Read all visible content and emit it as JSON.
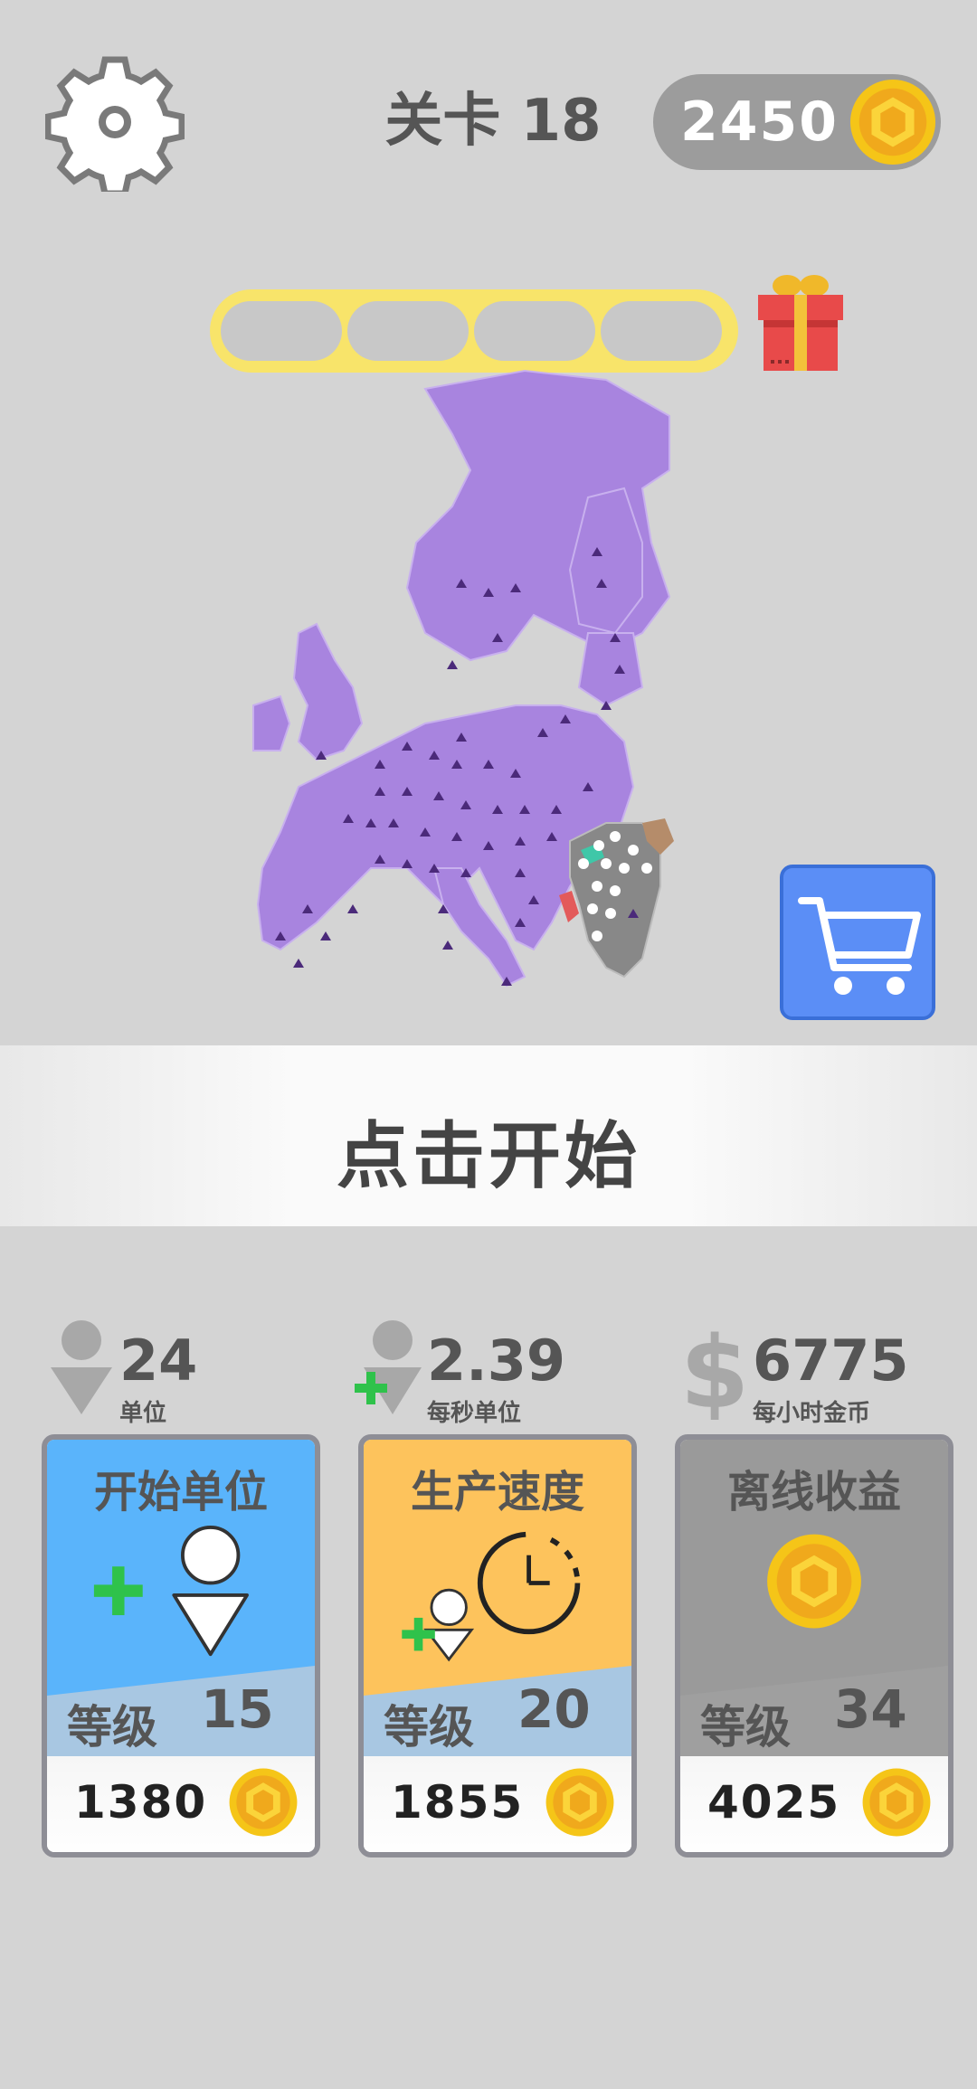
{
  "header": {
    "level_title": "关卡 18",
    "coins": "2450"
  },
  "progress": {
    "segments_total": 4,
    "segments_filled": 0
  },
  "banner": {
    "tap_to_start": "点击开始"
  },
  "stats": [
    {
      "value": "24",
      "label": "单位",
      "icon": "person-icon"
    },
    {
      "value": "2.39",
      "label": "每秒单位",
      "icon": "person-plus-icon"
    },
    {
      "value": "6775",
      "label": "每小时金币",
      "icon": "dollar-icon"
    }
  ],
  "cards": [
    {
      "title": "开始单位",
      "level_label": "等级",
      "level": "15",
      "price": "1380",
      "icon": "add-unit-icon"
    },
    {
      "title": "生产速度",
      "level_label": "等级",
      "level": "20",
      "price": "1855",
      "icon": "speed-clock-icon"
    },
    {
      "title": "离线收益",
      "level_label": "等级",
      "level": "34",
      "price": "4025",
      "icon": "coin-icon"
    }
  ],
  "colors": {
    "background": "#d4d4d4",
    "player_territory": "#a884df",
    "enemy_territory": "#888888",
    "card_blue": "#5ab4fb",
    "card_orange": "#fdc35c",
    "card_gray": "#9a9a9a",
    "shop_blue": "#5b8ef6",
    "progress_yellow": "#f8e46a",
    "coin_gold": "#f5c518"
  }
}
